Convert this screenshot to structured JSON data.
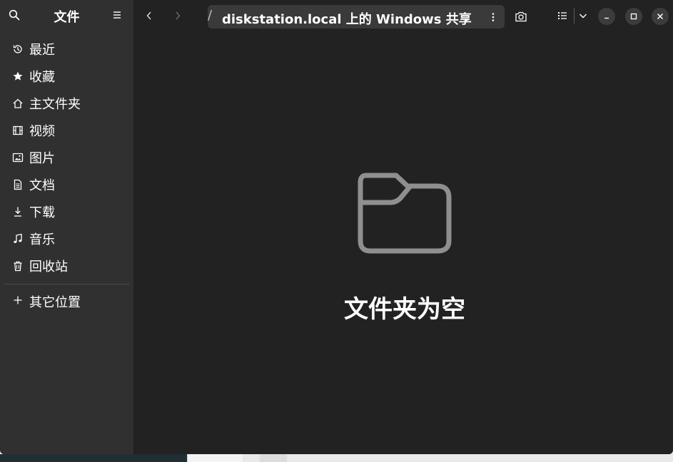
{
  "sidebar": {
    "title": "文件",
    "items": [
      {
        "label": "最近",
        "icon": "clock-icon"
      },
      {
        "label": "收藏",
        "icon": "star-icon"
      },
      {
        "label": "主文件夹",
        "icon": "home-icon"
      },
      {
        "label": "视频",
        "icon": "film-icon"
      },
      {
        "label": "图片",
        "icon": "image-icon"
      },
      {
        "label": "文档",
        "icon": "document-icon"
      },
      {
        "label": "下载",
        "icon": "download-icon"
      },
      {
        "label": "音乐",
        "icon": "music-icon"
      },
      {
        "label": "回收站",
        "icon": "trash-icon"
      }
    ],
    "other_locations": {
      "label": "其它位置",
      "icon": "plus-icon"
    }
  },
  "header": {
    "path_separator": "/",
    "location": "diskstation.local 上的 Windows 共享"
  },
  "content": {
    "empty_message": "文件夹为空",
    "icon": "folder-icon"
  },
  "colors": {
    "sidebar_bg": "#303030",
    "content_bg": "#222222",
    "pathbar_bg": "#3a3a3a",
    "text": "#ffffff"
  }
}
